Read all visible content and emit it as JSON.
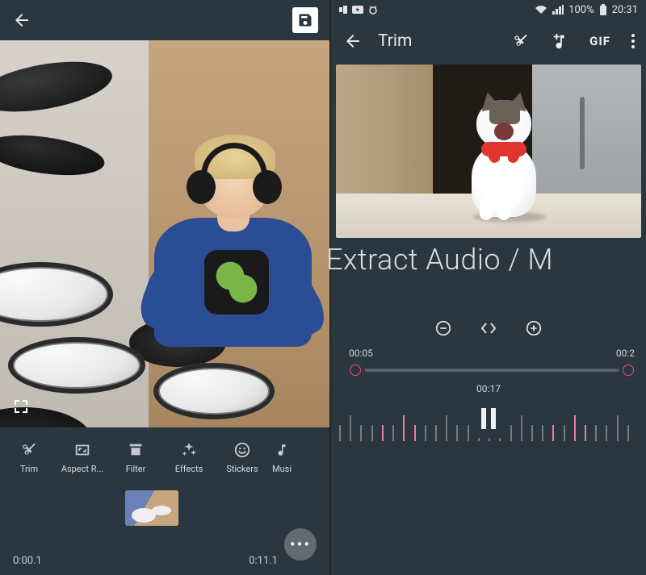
{
  "left_phone": {
    "toolbar": {
      "items": [
        {
          "label": "Trim"
        },
        {
          "label": "Aspect R..."
        },
        {
          "label": "Filter"
        },
        {
          "label": "Effects"
        },
        {
          "label": "Stickers"
        },
        {
          "label": "Musi"
        }
      ]
    },
    "timeline": {
      "start": "0:00.1",
      "end": "0:11.1"
    }
  },
  "right_phone": {
    "status": {
      "battery": "100%",
      "time": "20:31"
    },
    "title": "Trim",
    "gif_label": "GIF",
    "subtitle": "Extract Audio / M",
    "trim": {
      "left_time": "00:05",
      "right_time": "00:2",
      "center_time": "00:17"
    }
  }
}
